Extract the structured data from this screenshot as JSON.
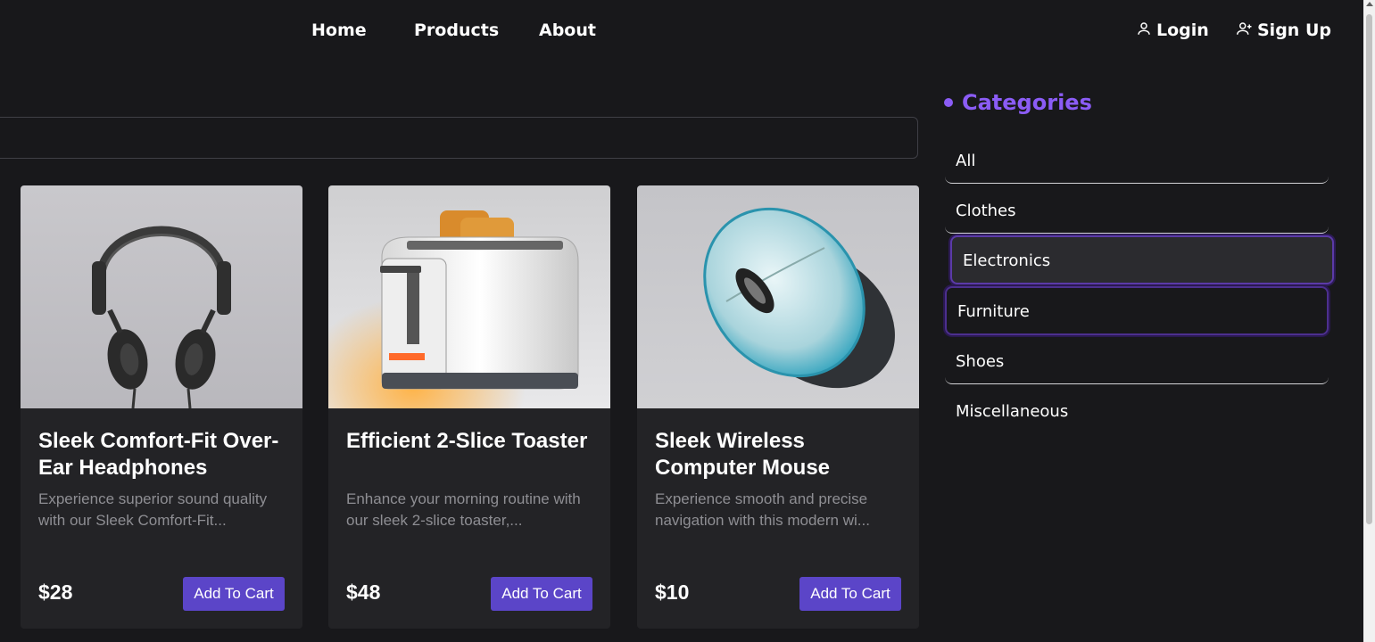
{
  "nav": {
    "links": [
      "Home",
      "Products",
      "About"
    ],
    "login": "Login",
    "signup": "Sign Up"
  },
  "search": {
    "placeholder": ""
  },
  "products": [
    {
      "title": "Sleek Comfort-Fit Over-Ear Headphones",
      "description": "Experience superior sound quality with our Sleek Comfort-Fit...",
      "price": "$28",
      "button": "Add To Cart"
    },
    {
      "title": "Efficient 2-Slice Toaster",
      "description": "Enhance your morning routine with our sleek 2-slice toaster,...",
      "price": "$48",
      "button": "Add To Cart"
    },
    {
      "title": "Sleek Wireless Computer Mouse",
      "description": "Experience smooth and precise navigation with this modern wi...",
      "price": "$10",
      "button": "Add To Cart"
    }
  ],
  "categories": {
    "heading": "Categories",
    "items": [
      "All",
      "Clothes",
      "Electronics",
      "Furniture",
      "Shoes",
      "Miscellaneous"
    ]
  },
  "colors": {
    "accent": "#8b5cf6",
    "button": "#5b45c8",
    "background": "#18181b",
    "card": "#232326"
  },
  "icons": {
    "login": "user-icon",
    "signup": "user-plus-icon"
  }
}
